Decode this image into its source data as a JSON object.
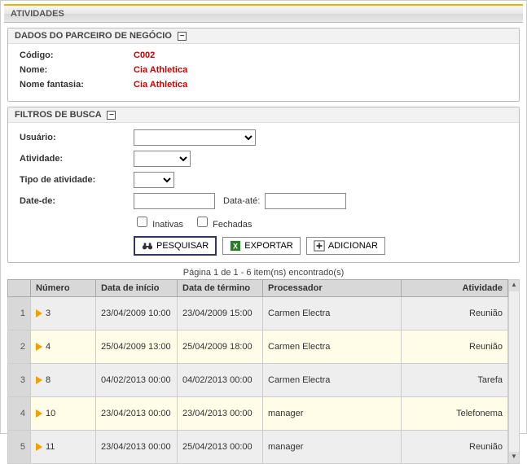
{
  "title": "ATIVIDADES",
  "partner": {
    "header": "DADOS DO PARCEIRO DE NEGÓCIO",
    "labels": {
      "codigo": "Código:",
      "nome": "Nome:",
      "fantasia": "Nome fantasia:"
    },
    "values": {
      "codigo": "C002",
      "nome": "Cia Athletica",
      "fantasia": "Cia Athletica"
    }
  },
  "filters": {
    "header": "FILTROS DE BUSCA",
    "labels": {
      "usuario": "Usuário:",
      "atividade": "Atividade:",
      "tipo": "Tipo de atividade:",
      "date_de": "Date-de:",
      "data_ate": "Data-até:"
    },
    "checkboxes": {
      "inativas": "Inativas",
      "fechadas": "Fechadas"
    },
    "buttons": {
      "pesquisar": "PESQUISAR",
      "exportar": "EXPORTAR",
      "adicionar": "ADICIONAR"
    }
  },
  "pagination": "Página 1 de 1 - 6 item(ns) encontrado(s)",
  "columns": {
    "numero": "Número",
    "inicio": "Data de início",
    "termino": "Data de término",
    "processador": "Processador",
    "atividade": "Atividade"
  },
  "rows": [
    {
      "idx": "1",
      "numero": "3",
      "inicio": "23/04/2009 10:00",
      "termino": "23/04/2009 15:00",
      "processador": "Carmen Electra",
      "atividade": "Reunião"
    },
    {
      "idx": "2",
      "numero": "4",
      "inicio": "25/04/2009 13:00",
      "termino": "25/04/2009 18:00",
      "processador": "Carmen Electra",
      "atividade": "Reunião"
    },
    {
      "idx": "3",
      "numero": "8",
      "inicio": "04/02/2013 00:00",
      "termino": "04/02/2013 00:00",
      "processador": "Carmen Electra",
      "atividade": "Tarefa"
    },
    {
      "idx": "4",
      "numero": "10",
      "inicio": "23/04/2013 00:00",
      "termino": "23/04/2013 00:00",
      "processador": "manager",
      "atividade": "Telefonema"
    },
    {
      "idx": "5",
      "numero": "11",
      "inicio": "23/04/2013 00:00",
      "termino": "25/04/2013 00:00",
      "processador": "manager",
      "atividade": "Reunião"
    }
  ]
}
